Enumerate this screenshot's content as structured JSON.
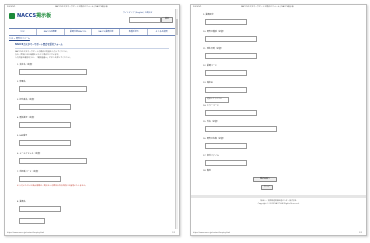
{
  "page1": {
    "header_small": "2023/9/1",
    "header_center": "NACCSカスタマーサポートお問合せフォーム | NACCS掲示板",
    "logo_text": "NACCS",
    "logo_text_suffix": "掲示板",
    "top_links": "サイトマップ | English | お問合せ",
    "search_button": "検索",
    "nav_tabs": [
      "TOP",
      "NACCSの概要",
      "業務仕様(NACCS)",
      "NACCS業務仕様",
      "各種手続き",
      "よくある質問"
    ],
    "breadcrumb": "TOP > 問合せフォーム",
    "section_title": "NACCSカスタマーサポート問合せ受付フォーム",
    "intro_lines": [
      "NACCSカスタマーサポートの問合せ内容を入力してください。",
      "なお、回答にはお時間をいただく場合がございます。",
      "入力内容を確認のうえ、「確認画面へ」ボタンを押してください。"
    ],
    "labels": [
      "1. 会社名（必須）",
      "2. 部署名",
      "3. 担当者名（必須）",
      "4. 電話番号（必須）",
      "5. FAX番号",
      "6. メールアドレス（必須）",
      "7. 利用者コード（必須）",
      "8. 業務名"
    ],
    "notice": "※ 入力いただいた個人情報は、問合せへの回答以外の目的には使用いたしません。",
    "url": "https://www.naccs.jp/contact/inquiry.html",
    "page_no": "1/2"
  },
  "page2": {
    "header_small": "2023/9/1",
    "header_center": "NACCSカスタマーサポートお問合せフォーム | NACCS掲示板",
    "labels": [
      "9. 業務区分",
      "10. 問合せ種別（必須）",
      "11. 発生日時（必須）",
      "12. 業務コード",
      "13. 端末ID",
      "14. エラーコード",
      "15. 件名（必須）",
      "16. 問合せ内容（必須）",
      "17. 添付ファイル",
      "18. 備考"
    ],
    "select_value": "選択してください",
    "confirm_button": "確認画面へ",
    "reset_button": "クリア",
    "footer_lines": [
      "輸出入・港湾関連情報処理センター株式会社",
      "Copyright © 2023 NACCS All Rights Reserved."
    ],
    "url": "https://www.naccs.jp/contact/inquiry.html",
    "page_no": "2/2"
  }
}
